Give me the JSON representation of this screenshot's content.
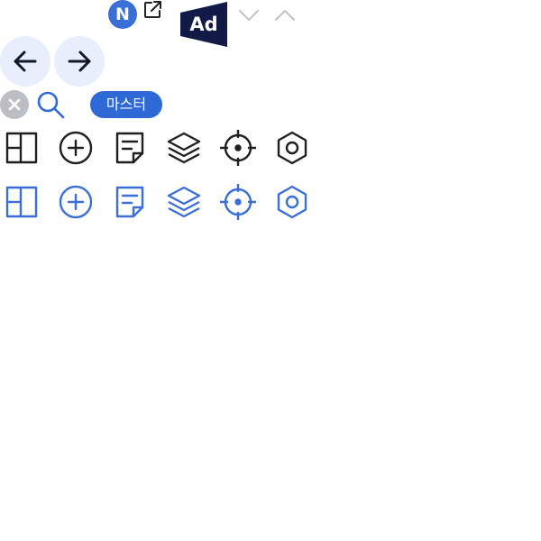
{
  "header": {
    "user_initial": "N",
    "ad_label": "Ad"
  },
  "search": {
    "chip_label": "마스터"
  },
  "icons": {
    "dark_row": [
      "layout-icon",
      "add-circle-icon",
      "document-icon",
      "layers-icon",
      "target-icon",
      "settings-icon"
    ],
    "blue_row": [
      "layout-icon",
      "add-circle-icon",
      "document-icon",
      "layers-icon",
      "target-icon",
      "settings-icon"
    ]
  },
  "colors": {
    "accent": "#3b6fd8",
    "chip": "#2f69d6",
    "ad_background": "#121a47",
    "nav_background": "#e8eefb",
    "dark_icon": "#1f1f1f",
    "muted": "#bdbdc5"
  }
}
